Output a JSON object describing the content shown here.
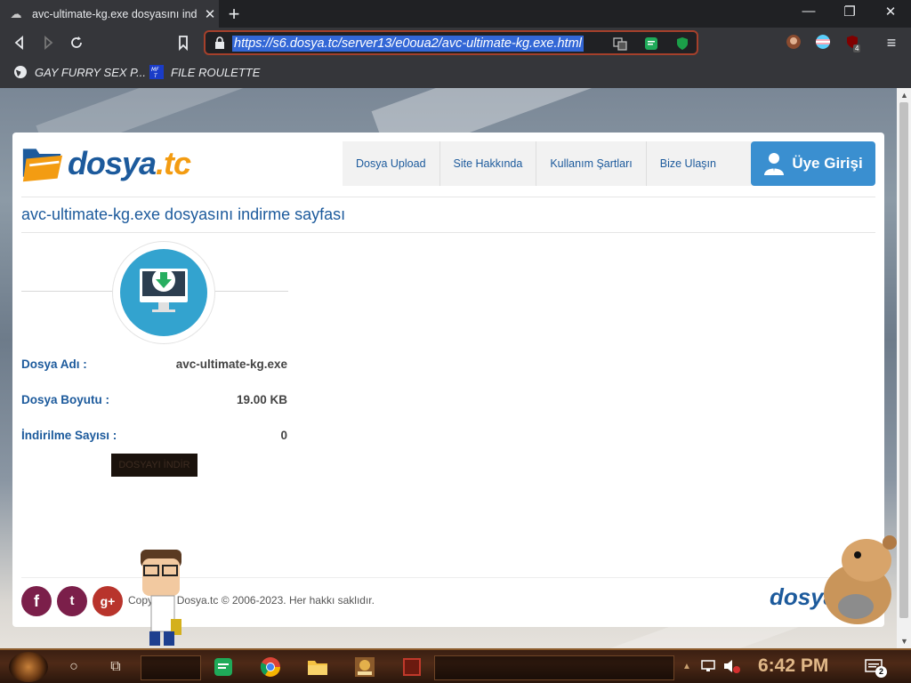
{
  "browser": {
    "tab_title": "avc-ultimate-kg.exe dosyasını indirme sayfası",
    "tab_close": "✕",
    "new_tab": "+",
    "url": "https://s6.dosya.tc/server13/e0oua2/avc-ultimate-kg.exe.html",
    "extension_badge": "4",
    "window_controls": {
      "minimize": "—",
      "maximize": "❐",
      "close": "✕"
    }
  },
  "bookmarks": [
    {
      "label": "GAY FURRY SEX P...",
      "icon": "globe-icon"
    },
    {
      "label": "FILE ROULETTE",
      "icon": "mft-icon"
    }
  ],
  "site": {
    "logo_main": "dosya",
    "logo_tld": ".tc",
    "menu": [
      "Dosya Upload",
      "Site Hakkında",
      "Kullanım Şartları",
      "Bize Ulaşın"
    ],
    "login_label": "Üye Girişi",
    "page_title": "avc-ultimate-kg.exe dosyasını indirme sayfası",
    "file_info": [
      {
        "label": "Dosya Adı :",
        "value": "avc-ultimate-kg.exe"
      },
      {
        "label": "Dosya Boyutu :",
        "value": "19.00 KB"
      },
      {
        "label": "İndirilme Sayısı :",
        "value": "0"
      }
    ],
    "download_button": "DOSYAYI İNDİR",
    "social": [
      {
        "name": "facebook",
        "glyph": "f",
        "color": "#7b1f4a"
      },
      {
        "name": "twitter",
        "glyph": "t",
        "color": "#7b1f4a"
      },
      {
        "name": "google-plus",
        "glyph": "g+",
        "color": "#b8342c"
      }
    ],
    "copyright": "Copyright Dosya.tc © 2006-2023. Her hakkı saklıdır.",
    "footer_logo": "dosya"
  },
  "taskbar": {
    "clock": "6:42 PM",
    "notification_count": "2",
    "icons": [
      "cortana-icon",
      "task-view-icon",
      "notes-icon",
      "chrome-icon",
      "folder-icon",
      "game-icon",
      "media-icon"
    ]
  },
  "colors": {
    "brand_blue": "#1c5a9c",
    "brand_orange": "#f39c12",
    "login_blue": "#3a8fd0",
    "url_highlight": "#3367d6"
  }
}
